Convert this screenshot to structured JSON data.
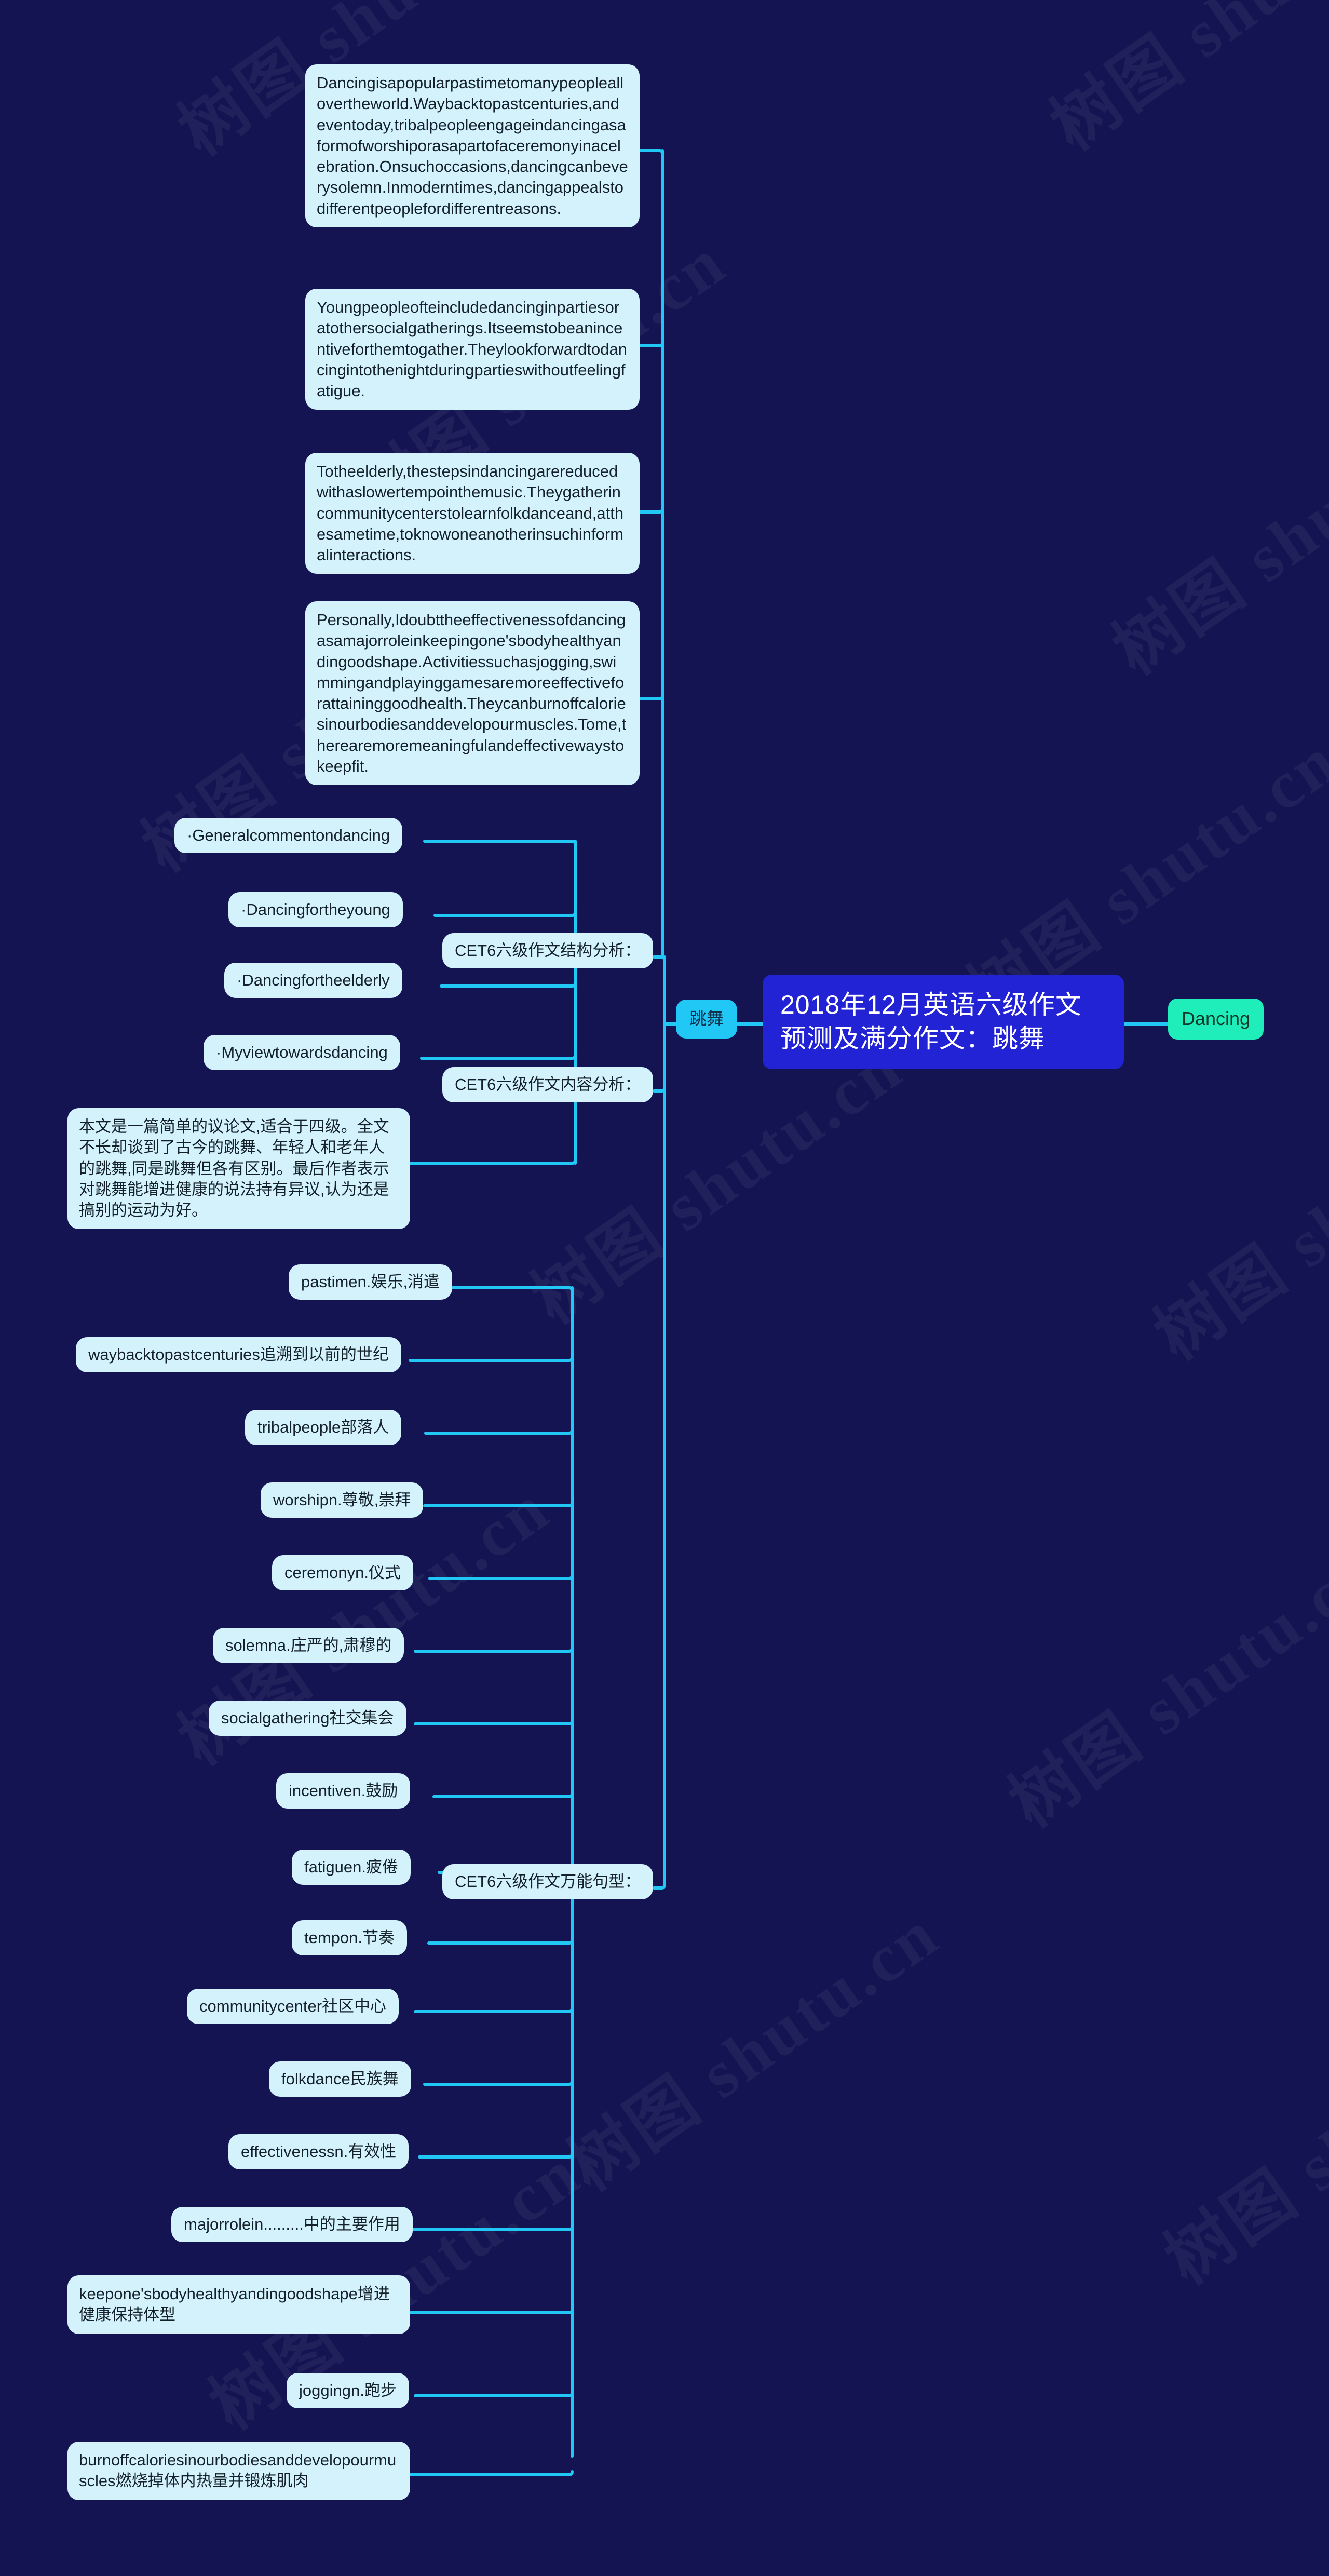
{
  "theme": {
    "background": "#141452",
    "node_pale": "#d3f2fb",
    "node_cyan": "#21c7f5",
    "node_root": "#2323d6",
    "node_green": "#1fedba",
    "wire": "#21c7f5",
    "text_dark": "#14212b",
    "text_light": "#ffffff"
  },
  "watermark": {
    "text": "树图 shutu.cn"
  },
  "root": {
    "label": "2018年12月英语六级作文预测及满分作文：跳舞"
  },
  "right_branch": {
    "label": "Dancing"
  },
  "left_branch": {
    "label": "跳舞"
  },
  "categories": [
    {
      "label": "CET6六级作文结构分析："
    },
    {
      "label": "CET6六级作文内容分析："
    },
    {
      "label": "CET6六级作文万能句型："
    }
  ],
  "essay_paragraphs": [
    {
      "text": "Dancingisapopularpastimetomanypeopleallovertheworld.Waybacktopastcenturies,andeventoday,tribalpeopleengageindancingasaformofworshiporasapartofaceremonyinacelebration.Onsuchoccasions,dancingcanbeverysolemn.Inmoderntimes,dancingappealstodifferentpeoplefordifferentreasons."
    },
    {
      "text": "Youngpeopleofteincludedancinginpartiesoratothersocialgatherings.Itseemstobeanincentiveforthemtogather.Theylookforwardtodancingintothenightduringpartieswithoutfeelingfatigue."
    },
    {
      "text": "Totheelderly,thestepsindancingarereducedwithaslowertempointhemusic.Theygatherincommunitycenterstolearnfolkdanceand,atthesametime,toknowoneanotherinsuchinformalinteractions."
    },
    {
      "text": "Personally,Idoubttheeffectivenessofdancingasamajorroleinkeepingone'sbodyhealthyandingoodshape.Activitiessuchasjogging,swimmingandplayinggamesaremoreeffectiveforattaininggoodhealth.Theycanburnoffcaloriesinourbodiesanddevelopourmuscles.Tome,therearemoremeaningfulandeffectivewaystokeepfit."
    }
  ],
  "structure_items": [
    {
      "label": "·Generalcommentondancing"
    },
    {
      "label": "·Dancingfortheyoung"
    },
    {
      "label": "·Dancingfortheelderly"
    },
    {
      "label": "·Myviewtowardsdancing"
    }
  ],
  "content_analysis": {
    "text": "本文是一篇简单的议论文,适合于四级。全文不长却谈到了古今的跳舞、年轻人和老年人的跳舞,同是跳舞但各有区别。最后作者表示对跳舞能增进健康的说法持有异议,认为还是搞别的运动为好。"
  },
  "vocabulary_items": [
    {
      "label": "pastimen.娱乐,消遣"
    },
    {
      "label": "waybacktopastcenturies追溯到以前的世纪"
    },
    {
      "label": "tribalpeople部落人"
    },
    {
      "label": "worshipn.尊敬,崇拜"
    },
    {
      "label": "ceremonyn.仪式"
    },
    {
      "label": "solemna.庄严的,肃穆的"
    },
    {
      "label": "socialgathering社交集会"
    },
    {
      "label": "incentiven.鼓励"
    },
    {
      "label": "fatiguen.疲倦"
    },
    {
      "label": "tempon.节奏"
    },
    {
      "label": "communitycenter社区中心"
    },
    {
      "label": "folkdance民族舞"
    },
    {
      "label": "effectivenessn.有效性"
    },
    {
      "label": "majorrolein.........中的主要作用"
    },
    {
      "label": "keepone'sbodyhealthyandingoodshape增进健康保持体型"
    },
    {
      "label": "joggingn.跑步"
    },
    {
      "label": "burnoffcaloriesinourbodiesanddevelopourmuscles燃烧掉体内热量并锻炼肌肉"
    }
  ]
}
